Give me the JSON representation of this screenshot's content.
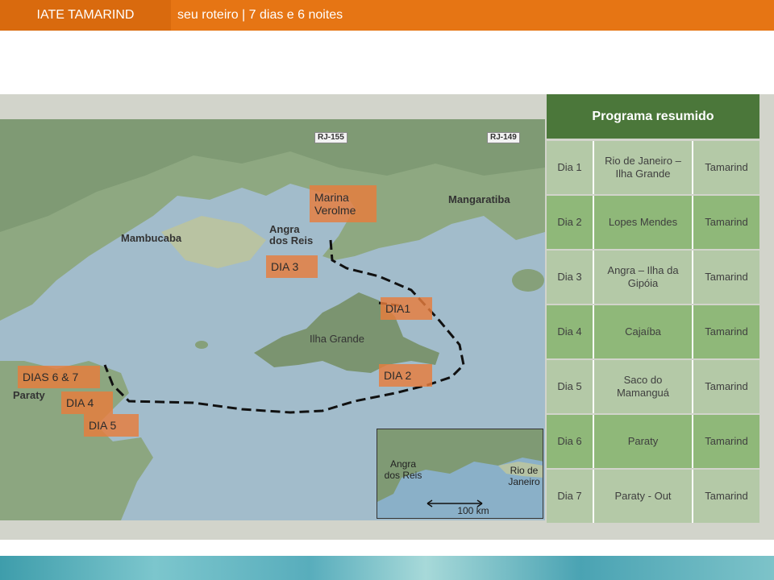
{
  "header": {
    "brand": "IATE TAMARIND",
    "subtitle": "seu roteiro | 7 dias e 6 noites",
    "accent": "#e67514"
  },
  "map": {
    "road_signs": [
      "RJ-155",
      "RJ-149"
    ],
    "place_labels": {
      "mambucaba": "Mambucaba",
      "angra": "Angra dos Reis",
      "mangaratiba": "Mangaratiba",
      "ilha_grande": "Ilha Grande",
      "paraty": "Paraty"
    },
    "stop_tags": {
      "marina": "Marina Verolme",
      "dia3": "DIA 3",
      "dia1": "DIA1",
      "dia2": "DIA 2",
      "dias67": "DIAS  6 & 7",
      "dia4": "DIA 4",
      "dia5": "DIA 5"
    },
    "inset": {
      "angra": "Angra dos Reis",
      "rio": "Rio de Janeiro",
      "scale": "100 km"
    }
  },
  "program": {
    "title": "Programa resumido",
    "rows": [
      {
        "day": "Dia 1",
        "route": "Rio de Janeiro – Ilha Grande",
        "boat": "Tamarind"
      },
      {
        "day": "Dia  2",
        "route": "Lopes Mendes",
        "boat": "Tamarind"
      },
      {
        "day": "Dia  3",
        "route": "Angra – Ilha da Gipóia",
        "boat": "Tamarind"
      },
      {
        "day": "Dia  4",
        "route": "Cajaíba",
        "boat": "Tamarind"
      },
      {
        "day": "Dia 5",
        "route": "Saco do Mamanguá",
        "boat": "Tamarind"
      },
      {
        "day": "Dia 6",
        "route": "Paraty",
        "boat": "Tamarind"
      },
      {
        "day": "Dia 7",
        "route": "Paraty - Out",
        "boat": "Tamarind"
      }
    ],
    "colors": {
      "title": "#4b773a",
      "row_light": "#b4c9a7",
      "row_dark": "#8fb879"
    }
  }
}
